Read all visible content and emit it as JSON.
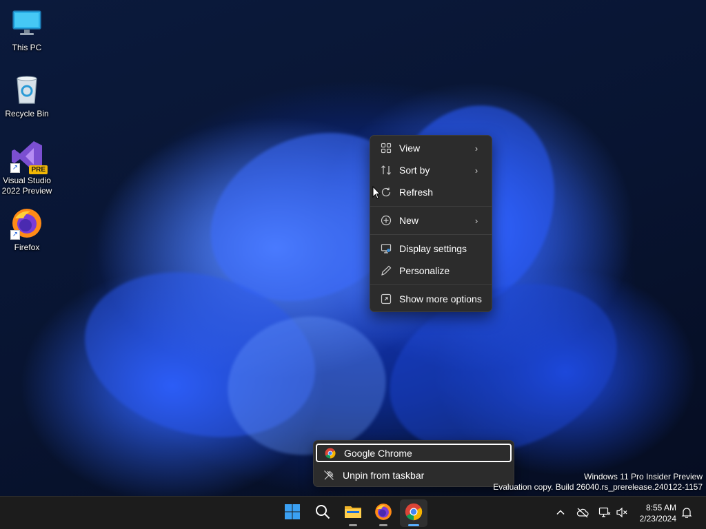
{
  "desktop": {
    "icons": [
      {
        "label": "This PC"
      },
      {
        "label": "Recycle Bin"
      },
      {
        "label": "Visual Studio\n2022 Preview",
        "badge": "PRE"
      },
      {
        "label": "Firefox"
      }
    ]
  },
  "context_menu": {
    "items": [
      {
        "label": "View",
        "icon": "grid-view-icon",
        "submenu": true
      },
      {
        "label": "Sort by",
        "icon": "sort-icon",
        "submenu": true
      },
      {
        "label": "Refresh",
        "icon": "refresh-icon",
        "submenu": false
      },
      {
        "label": "New",
        "icon": "plus-circle-icon",
        "submenu": true
      },
      {
        "label": "Display settings",
        "icon": "display-icon",
        "submenu": false
      },
      {
        "label": "Personalize",
        "icon": "pen-icon",
        "submenu": false
      },
      {
        "label": "Show more options",
        "icon": "expand-icon",
        "submenu": false
      }
    ]
  },
  "jump_list": {
    "items": [
      {
        "label": "Google Chrome",
        "icon": "chrome-icon",
        "focused": true
      },
      {
        "label": "Unpin from taskbar",
        "icon": "unpin-icon",
        "focused": false
      }
    ]
  },
  "watermark": {
    "line1": "Windows 11 Pro Insider Preview",
    "line2": "Evaluation copy. Build 26040.rs_prerelease.240122-1157"
  },
  "taskbar": {
    "apps": [
      {
        "name": "start",
        "icon": "windows-logo-icon"
      },
      {
        "name": "search",
        "icon": "search-icon"
      },
      {
        "name": "file-explorer",
        "icon": "folder-icon"
      },
      {
        "name": "firefox",
        "icon": "firefox-icon"
      },
      {
        "name": "chrome",
        "icon": "chrome-icon",
        "active": true
      }
    ],
    "tray": {
      "icons": [
        "chevron-up-icon",
        "cloud-off-icon",
        "network-icon",
        "volume-muted-icon",
        "notification-bell-icon"
      ],
      "time": "8:55 AM",
      "date": "2/23/2024"
    }
  },
  "colors": {
    "accent": "#5ab0ff",
    "menu_bg": "#2c2c2c",
    "taskbar_bg": "#1c1c1c"
  }
}
